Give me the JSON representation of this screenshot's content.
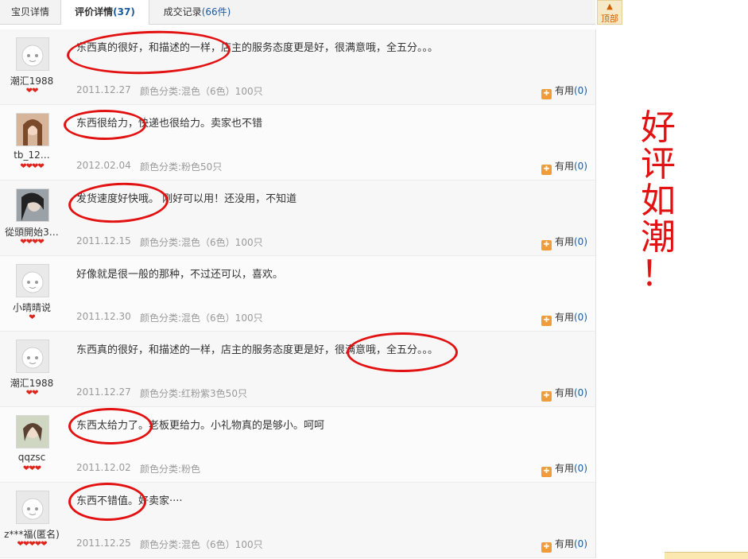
{
  "tabs": [
    {
      "label": "宝贝详情",
      "count": ""
    },
    {
      "label": "评价详情",
      "count": "(37)"
    },
    {
      "label": "成交记录",
      "count": "(66件)"
    }
  ],
  "top_button": {
    "label": "顶部"
  },
  "useful_label": "有用",
  "reviews": [
    {
      "user": "潮汇1988",
      "hearts": "❤❤",
      "comment": "东西真的很好，和描述的一样，店主的服务态度更是好，很满意哦，全五分。。。",
      "date": "2011.12.27",
      "spec": "颜色分类:混色（6色）100只",
      "useful": "(0)"
    },
    {
      "user": "tb_12…",
      "hearts": "❤❤❤❤",
      "comment": "东西很给力，快递也很给力。卖家也不错",
      "date": "2012.02.04",
      "spec": "颜色分类:粉色50只",
      "useful": "(0)"
    },
    {
      "user": "從頭開始3…",
      "hearts": "❤❤❤❤",
      "comment": "发货速度好快哦。  刚好可以用！还没用，不知道",
      "date": "2011.12.15",
      "spec": "颜色分类:混色（6色）100只",
      "useful": "(0)"
    },
    {
      "user": "小晴晴说",
      "hearts": "❤",
      "comment": "好像就是很一般的那种，不过还可以，喜欢。",
      "date": "2011.12.30",
      "spec": "颜色分类:混色（6色）100只",
      "useful": "(0)"
    },
    {
      "user": "潮汇1988",
      "hearts": "❤❤",
      "comment": "东西真的很好，和描述的一样，店主的服务态度更是好，很满意哦，全五分。。。",
      "date": "2011.12.27",
      "spec": "颜色分类:红粉紫3色50只",
      "useful": "(0)"
    },
    {
      "user": "qqzsc",
      "hearts": "❤❤❤",
      "comment": "东西太给力了。老板更给力。小礼物真的是够小。呵呵",
      "date": "2011.12.02",
      "spec": "颜色分类:粉色",
      "useful": "(0)"
    },
    {
      "user": "z***福(匿名)",
      "hearts": "❤❤❤❤❤",
      "comment": "东西不错值。好卖家····",
      "date": "2011.12.25",
      "spec": "颜色分类:混色（6色）100只",
      "useful": "(0)"
    }
  ],
  "annotation": {
    "line1": "好",
    "line2": "评",
    "line3": "如",
    "line4": "潮",
    "line5": "！"
  },
  "colors": {
    "annotation": "#e31212",
    "link": "#1b5a9c",
    "muted": "#9a9a9a"
  }
}
